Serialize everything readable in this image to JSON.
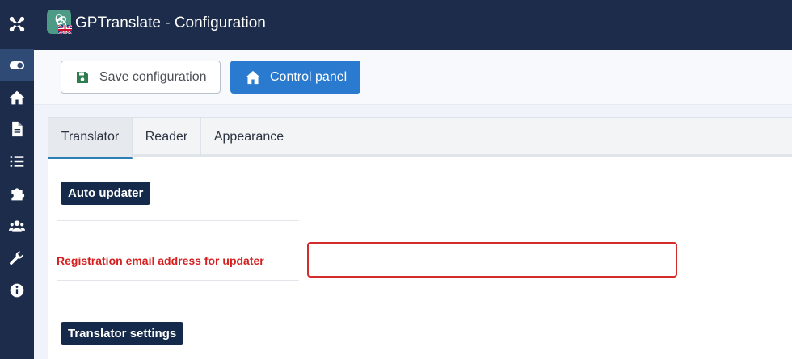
{
  "header": {
    "title": "GPTranslate - Configuration"
  },
  "toolbar": {
    "save_label": "Save configuration",
    "control_panel_label": "Control panel"
  },
  "tabs": [
    {
      "label": "Translator",
      "active": true
    },
    {
      "label": "Reader",
      "active": false
    },
    {
      "label": "Appearance",
      "active": false
    }
  ],
  "sections": {
    "auto_updater": "Auto updater",
    "translator_settings": "Translator settings"
  },
  "fields": {
    "registration_email": {
      "label": "Registration email address for updater",
      "value": "",
      "placeholder": ""
    }
  },
  "sidebar": {
    "items": [
      {
        "icon": "toggle-icon",
        "active": true
      },
      {
        "icon": "home-icon"
      },
      {
        "icon": "file-icon"
      },
      {
        "icon": "list-icon"
      },
      {
        "icon": "puzzle-icon"
      },
      {
        "icon": "users-icon"
      },
      {
        "icon": "wrench-icon"
      },
      {
        "icon": "info-icon"
      }
    ]
  },
  "colors": {
    "sidebar_bg": "#1c2c4a",
    "primary_button": "#2a7ad0",
    "error": "#d62b2b",
    "section_label_bg": "#152a4a"
  }
}
